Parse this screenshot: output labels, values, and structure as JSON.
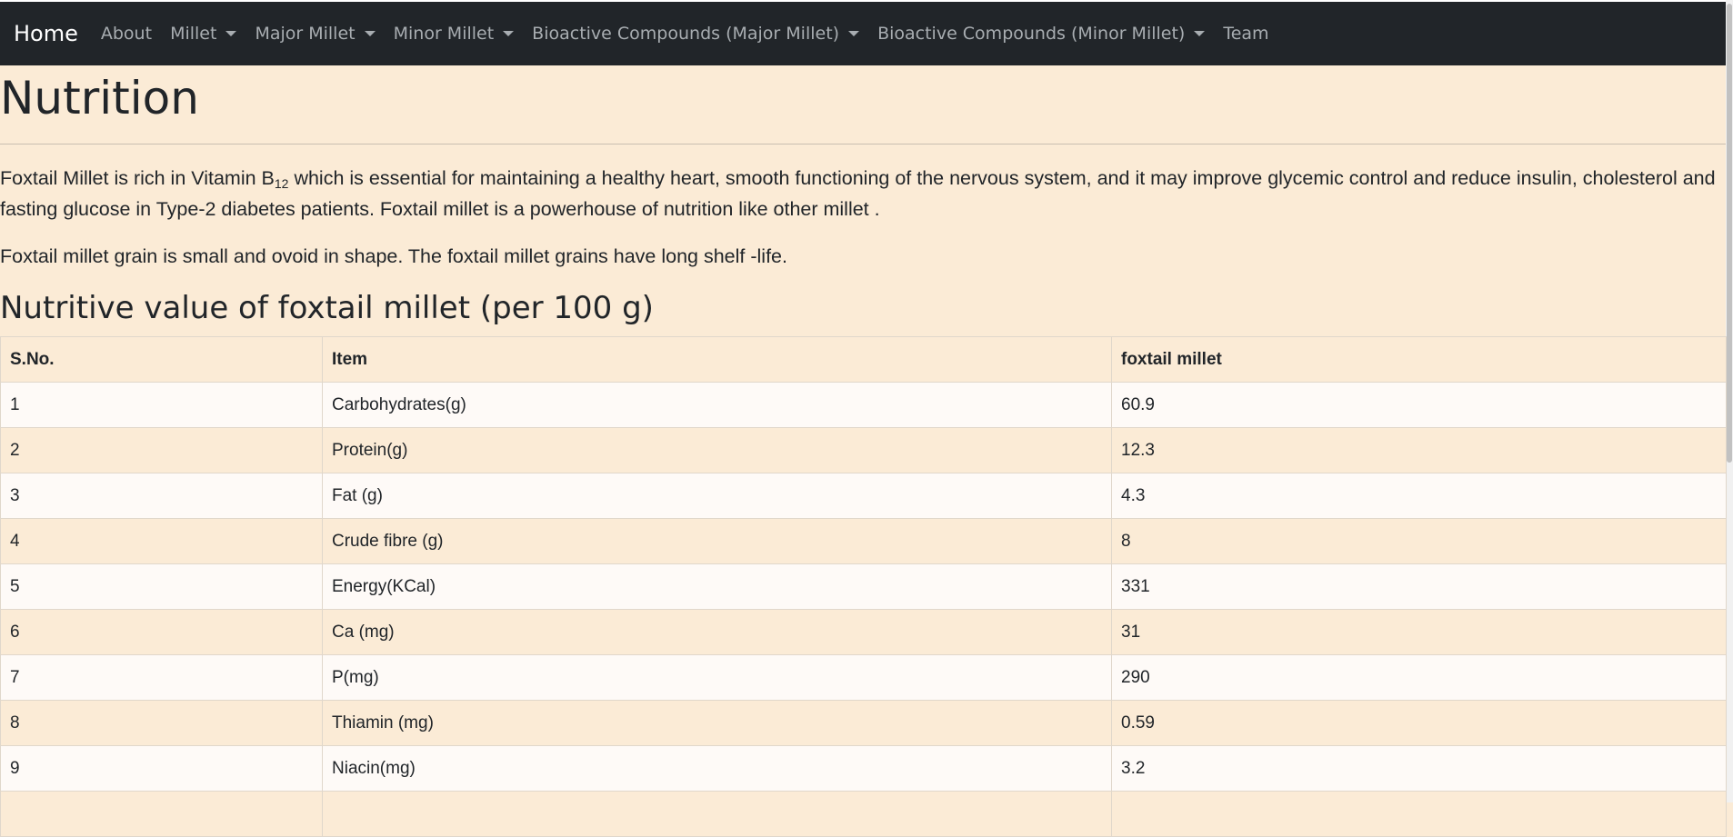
{
  "navbar": {
    "brand": "Home",
    "items": [
      {
        "label": "About",
        "dropdown": false
      },
      {
        "label": "Millet",
        "dropdown": true
      },
      {
        "label": "Major Millet",
        "dropdown": true
      },
      {
        "label": "Minor Millet",
        "dropdown": true
      },
      {
        "label": "Bioactive Compounds (Major Millet)",
        "dropdown": true
      },
      {
        "label": "Bioactive Compounds (Minor Millet)",
        "dropdown": true
      },
      {
        "label": "Team",
        "dropdown": false
      }
    ]
  },
  "page": {
    "title": "Nutrition",
    "para1_a": "Foxtail Millet is rich in Vitamin B",
    "para1_sub": "12",
    "para1_b": " which is essential for maintaining a healthy heart, smooth functioning of the nervous system, and it may improve glycemic control and reduce insulin, cholesterol and fasting glucose in Type-2 diabetes patients. Foxtail millet is a powerhouse of nutrition like other millet .",
    "para2": "Foxtail millet grain is small and ovoid in shape. The foxtail millet grains have long shelf -life.",
    "subtitle": "Nutritive value of foxtail millet (per 100 g)"
  },
  "table": {
    "headers": [
      "S.No.",
      "Item",
      "foxtail millet"
    ],
    "rows": [
      [
        "1",
        "Carbohydrates(g)",
        "60.9"
      ],
      [
        "2",
        "Protein(g)",
        "12.3"
      ],
      [
        "3",
        "Fat (g)",
        "4.3"
      ],
      [
        "4",
        "Crude fibre (g)",
        "8"
      ],
      [
        "5",
        "Energy(KCal)",
        "331"
      ],
      [
        "6",
        "Ca (mg)",
        "31"
      ],
      [
        "7",
        "P(mg)",
        "290"
      ],
      [
        "8",
        "Thiamin (mg)",
        "0.59"
      ],
      [
        "9",
        "Niacin(mg)",
        "3.2"
      ],
      [
        "",
        "",
        ""
      ]
    ]
  }
}
